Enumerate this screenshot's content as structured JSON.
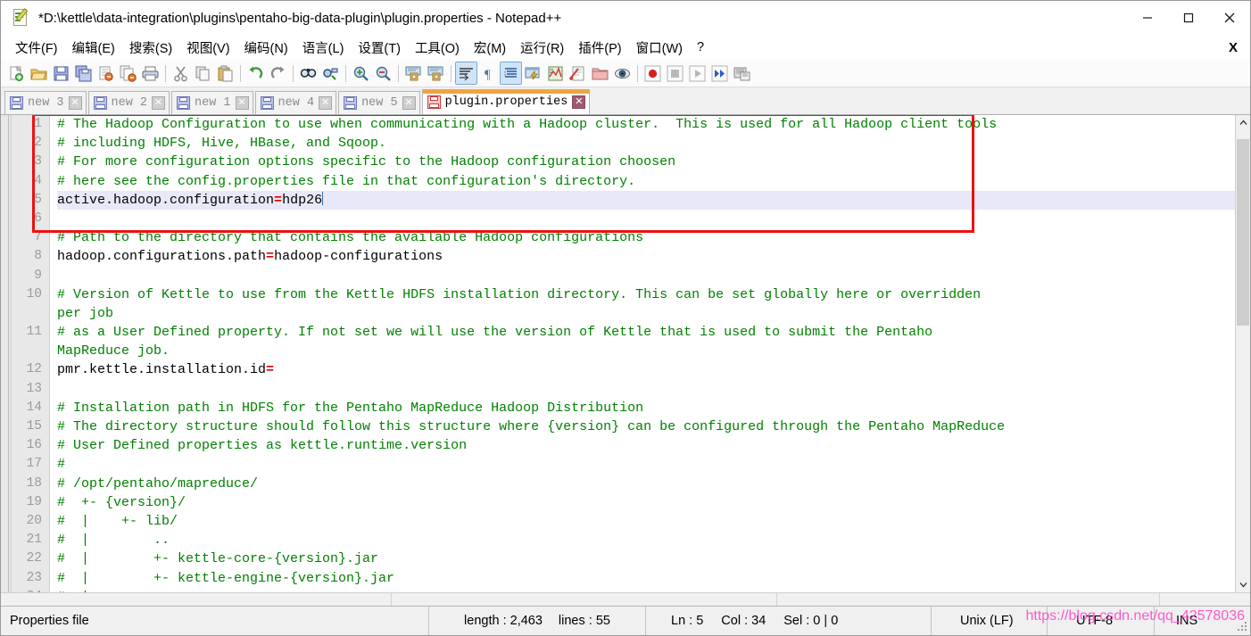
{
  "window": {
    "title": "*D:\\kettle\\data-integration\\plugins\\pentaho-big-data-plugin\\plugin.properties - Notepad++",
    "icon": "notepad-plus-plus-icon",
    "minimize_label": "–",
    "maximize_label": "□",
    "close_label": "✕"
  },
  "menubar": {
    "items": [
      {
        "label": "文件(F)"
      },
      {
        "label": "编辑(E)"
      },
      {
        "label": "搜索(S)"
      },
      {
        "label": "视图(V)"
      },
      {
        "label": "编码(N)"
      },
      {
        "label": "语言(L)"
      },
      {
        "label": "设置(T)"
      },
      {
        "label": "工具(O)"
      },
      {
        "label": "宏(M)"
      },
      {
        "label": "运行(R)"
      },
      {
        "label": "插件(P)"
      },
      {
        "label": "窗口(W)"
      },
      {
        "label": "?"
      }
    ],
    "close_document_label": "X"
  },
  "toolbar": {
    "buttons": [
      {
        "name": "new-file-icon",
        "active": false
      },
      {
        "name": "open-file-icon",
        "active": false
      },
      {
        "name": "save-icon",
        "active": false
      },
      {
        "name": "save-all-icon",
        "active": false
      },
      {
        "name": "close-file-icon",
        "active": false
      },
      {
        "name": "close-all-files-icon",
        "active": false
      },
      {
        "name": "print-icon",
        "active": false
      },
      {
        "name": "separator",
        "active": false
      },
      {
        "name": "cut-icon",
        "active": false
      },
      {
        "name": "copy-icon",
        "active": false
      },
      {
        "name": "paste-icon",
        "active": false
      },
      {
        "name": "separator",
        "active": false
      },
      {
        "name": "undo-icon",
        "active": false
      },
      {
        "name": "redo-icon",
        "active": false
      },
      {
        "name": "separator",
        "active": false
      },
      {
        "name": "find-icon",
        "active": false
      },
      {
        "name": "replace-icon",
        "active": false
      },
      {
        "name": "separator",
        "active": false
      },
      {
        "name": "zoom-in-icon",
        "active": false
      },
      {
        "name": "zoom-out-icon",
        "active": false
      },
      {
        "name": "separator",
        "active": false
      },
      {
        "name": "sync-vertical-scroll-icon",
        "active": false
      },
      {
        "name": "sync-horizontal-scroll-icon",
        "active": false
      },
      {
        "name": "separator",
        "active": false
      },
      {
        "name": "word-wrap-icon",
        "active": true
      },
      {
        "name": "show-all-characters-icon",
        "active": false
      },
      {
        "name": "indent-guide-icon",
        "active": true
      },
      {
        "name": "user-defined-language-icon",
        "active": false
      },
      {
        "name": "function-list-icon",
        "active": false
      },
      {
        "name": "document-map-icon",
        "active": false
      },
      {
        "name": "folder-as-workspace-icon",
        "active": false
      },
      {
        "name": "monitoring-icon",
        "active": false
      },
      {
        "name": "separator",
        "active": false
      },
      {
        "name": "record-macro-icon",
        "active": false
      },
      {
        "name": "stop-macro-icon",
        "active": false
      },
      {
        "name": "play-macro-icon",
        "active": false
      },
      {
        "name": "run-macro-multiple-icon",
        "active": false
      },
      {
        "name": "save-macro-icon",
        "active": false
      }
    ]
  },
  "tabs": [
    {
      "label": "new 3",
      "active": false,
      "close_label": "✕"
    },
    {
      "label": "new 2",
      "active": false,
      "close_label": "✕"
    },
    {
      "label": "new 1",
      "active": false,
      "close_label": "✕"
    },
    {
      "label": "new 4",
      "active": false,
      "close_label": "✕"
    },
    {
      "label": "new 5",
      "active": false,
      "close_label": "✕"
    },
    {
      "label": "plugin.properties",
      "active": true,
      "close_label": "✕"
    }
  ],
  "editor": {
    "line_numbers": [
      "1",
      "2",
      "3",
      "4",
      "5",
      "6",
      "7",
      "8",
      "9",
      "10",
      "",
      "11",
      "",
      "12",
      "13",
      "14",
      "15",
      "16",
      "17",
      "18",
      "19",
      "20",
      "21",
      "22",
      "23",
      "24",
      ""
    ],
    "lines": [
      {
        "num": "1",
        "type": "comment",
        "text": "# The Hadoop Configuration to use when communicating with a Hadoop cluster.  This is used for all Hadoop client tools"
      },
      {
        "num": "2",
        "type": "comment",
        "text": "# including HDFS, Hive, HBase, and Sqoop."
      },
      {
        "num": "3",
        "type": "comment",
        "text": "# For more configuration options specific to the Hadoop configuration choosen"
      },
      {
        "num": "4",
        "type": "comment",
        "text": "# here see the config.properties file in that configuration's directory."
      },
      {
        "num": "5",
        "type": "property",
        "key": "active.hadoop.configuration",
        "sep": "=",
        "value": "hdp26",
        "highlighted": true,
        "caret": true
      },
      {
        "num": "6",
        "type": "blank",
        "text": ""
      },
      {
        "num": "7",
        "type": "comment",
        "text": "# Path to the directory that contains the available Hadoop configurations"
      },
      {
        "num": "8",
        "type": "property",
        "key": "hadoop.configurations.path",
        "sep": "=",
        "value": "hadoop-configurations"
      },
      {
        "num": "9",
        "type": "blank",
        "text": ""
      },
      {
        "num": "10",
        "type": "comment",
        "text": "# Version of Kettle to use from the Kettle HDFS installation directory. This can be set globally here or overridden"
      },
      {
        "num": "",
        "type": "comment-wrap",
        "text": "per job"
      },
      {
        "num": "11",
        "type": "comment",
        "text": "# as a User Defined property. If not set we will use the version of Kettle that is used to submit the Pentaho"
      },
      {
        "num": "",
        "type": "comment-wrap",
        "text": "MapReduce job."
      },
      {
        "num": "12",
        "type": "property",
        "key": "pmr.kettle.installation.id",
        "sep": "=",
        "value": ""
      },
      {
        "num": "13",
        "type": "blank",
        "text": ""
      },
      {
        "num": "14",
        "type": "comment",
        "text": "# Installation path in HDFS for the Pentaho MapReduce Hadoop Distribution"
      },
      {
        "num": "15",
        "type": "comment",
        "text": "# The directory structure should follow this structure where {version} can be configured through the Pentaho MapReduce"
      },
      {
        "num": "16",
        "type": "comment",
        "text": "# User Defined properties as kettle.runtime.version"
      },
      {
        "num": "17",
        "type": "comment",
        "text": "#"
      },
      {
        "num": "18",
        "type": "comment",
        "text": "# /opt/pentaho/mapreduce/"
      },
      {
        "num": "19",
        "type": "comment",
        "text": "#  +- {version}/"
      },
      {
        "num": "20",
        "type": "comment",
        "text": "#  |    +- lib/"
      },
      {
        "num": "21",
        "type": "comment",
        "text": "#  |        .."
      },
      {
        "num": "22",
        "type": "comment",
        "text": "#  |        +- kettle-core-{version}.jar"
      },
      {
        "num": "23",
        "type": "comment",
        "text": "#  |        +- kettle-engine-{version}.jar"
      },
      {
        "num": "24",
        "type": "comment",
        "text": "#  |        .."
      }
    ],
    "annotation": {
      "name": "red-highlight-rectangle",
      "color": "#ee1111"
    },
    "colors": {
      "comment": "#008000",
      "property": "#000000",
      "equals": "#e00000",
      "current_line": "#e8e8f8"
    }
  },
  "statusbar": {
    "file_type": "Properties file",
    "length_label": "length : 2,463",
    "lines_label": "lines : 55",
    "ln_label": "Ln : 5",
    "col_label": "Col : 34",
    "sel_label": "Sel : 0 | 0",
    "eol": "Unix (LF)",
    "encoding": "UTF-8",
    "insert_mode": "INS"
  },
  "watermark": {
    "text": "https://blog.csdn.net/qq_42578036",
    "color": "#ff3ec8"
  }
}
